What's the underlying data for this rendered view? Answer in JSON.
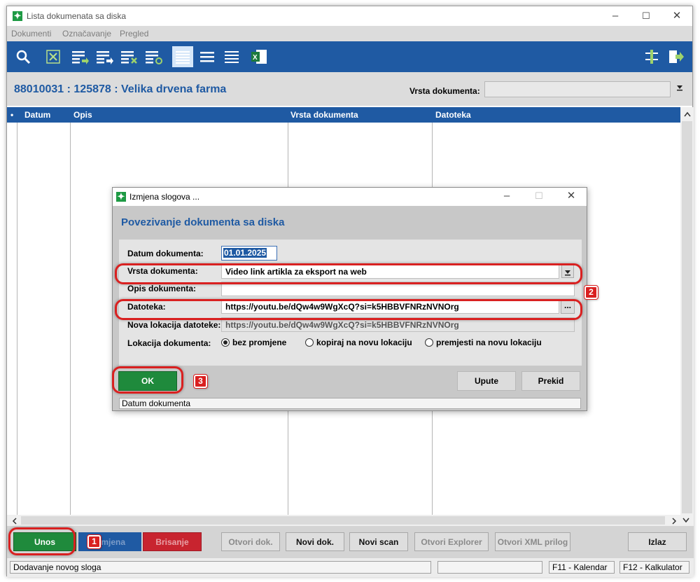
{
  "window": {
    "title": "Lista dokumenata sa diska",
    "controls": {
      "minimize": "–",
      "maximize": "☐",
      "close": "✕"
    }
  },
  "menu": [
    "Dokumenti",
    "Označavanje",
    "Pregled"
  ],
  "toolbar": {
    "icons": [
      "search-icon",
      "deselect-icon",
      "list-add-icon",
      "list-add-all-icon",
      "list-remove-icon",
      "list-refresh-icon",
      "view-list-icon",
      "view-lines-icon",
      "view-compact-icon",
      "excel-export-icon",
      "settings-sliders-icon",
      "exit-icon"
    ],
    "accent": "#1f5aa3"
  },
  "header": {
    "title": "88010031 : 125878 : Velika drvena farma",
    "filter_label": "Vrsta dokumenta:",
    "filter_value": ""
  },
  "grid": {
    "columns": [
      "•",
      "Datum",
      "Opis",
      "Vrsta dokumenta",
      "Datoteka"
    ]
  },
  "bottom_buttons": {
    "unos": "Unos",
    "izmjena": "Izmjena",
    "brisanje": "Brisanje",
    "otvori_dok": "Otvori dok.",
    "novi_dok": "Novi dok.",
    "novi_scan": "Novi scan",
    "otvori_explorer": "Otvori Explorer",
    "otvori_xml": "Otvori XML prilog",
    "izlaz": "Izlaz"
  },
  "statusbar": {
    "message": "Dodavanje novog sloga",
    "empty": "",
    "f11": "F11 - Kalendar",
    "f12": "F12 - Kalkulator"
  },
  "dialog": {
    "title": "Izmjena slogova ...",
    "heading": "Povezivanje dokumenta sa diska",
    "fields": {
      "datum_label": "Datum dokumenta:",
      "datum_value": "01.01.2025",
      "vrsta_label": "Vrsta dokumenta:",
      "vrsta_value": "Video link artikla za eksport na web",
      "opis_label": "Opis dokumenta:",
      "opis_value": "",
      "datoteka_label": "Datoteka:",
      "datoteka_value": "https://youtu.be/dQw4w9WgXcQ?si=k5HBBVFNRzNVNOrg",
      "nova_label": "Nova lokacija datoteke:",
      "nova_value": "https://youtu.be/dQw4w9WgXcQ?si=k5HBBVFNRzNVNOrg",
      "lokacija_label": "Lokacija dokumenta:"
    },
    "radios": [
      "bez promjene",
      "kopiraj na novu lokaciju",
      "premjesti na novu lokaciju"
    ],
    "selected_radio": "bez promjene",
    "browse_label": "...",
    "buttons": {
      "ok": "OK",
      "upute": "Upute",
      "prekid": "Prekid"
    },
    "status": "Datum dokumenta"
  },
  "annotations": {
    "badge1": "1",
    "badge2": "2",
    "badge3": "3",
    "color": "#d92020"
  }
}
